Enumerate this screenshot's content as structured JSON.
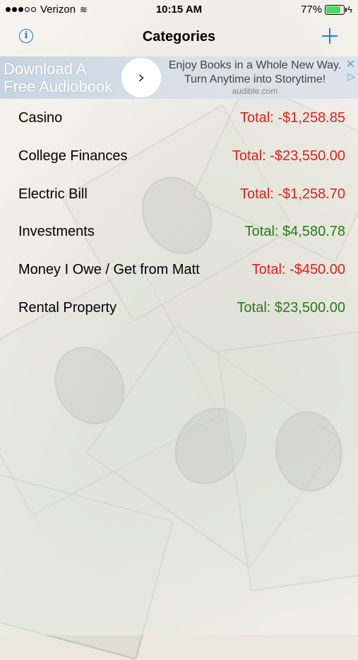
{
  "status_bar": {
    "carrier": "Verizon",
    "time": "10:15 AM",
    "battery_percent": "77%",
    "battery_level": 0.77
  },
  "navbar": {
    "title": "Categories",
    "info_icon": "info-icon",
    "add_icon": "plus-icon",
    "accent_color": "#1b78f2"
  },
  "ad": {
    "left_line1": "Download A",
    "left_line2": "Free Audiobook",
    "right_line1": "Enjoy Books in a Whole New Way.",
    "right_line2": "Turn Anytime into Storytime!",
    "domain": "audible.com"
  },
  "colors": {
    "negative": "#e0201a",
    "positive": "#2a7a16"
  },
  "categories": [
    {
      "name": "Casino",
      "total": "Total: -$1,258.85",
      "sign": "negative"
    },
    {
      "name": "College Finances",
      "total": "Total: -$23,550.00",
      "sign": "negative"
    },
    {
      "name": "Electric Bill",
      "total": "Total: -$1,258.70",
      "sign": "negative"
    },
    {
      "name": "Investments",
      "total": "Total: $4,580.78",
      "sign": "positive"
    },
    {
      "name": "Money I Owe / Get from Matt",
      "total": "Total: -$450.00",
      "sign": "negative"
    },
    {
      "name": "Rental Property",
      "total": "Total: $23,500.00",
      "sign": "positive"
    }
  ]
}
